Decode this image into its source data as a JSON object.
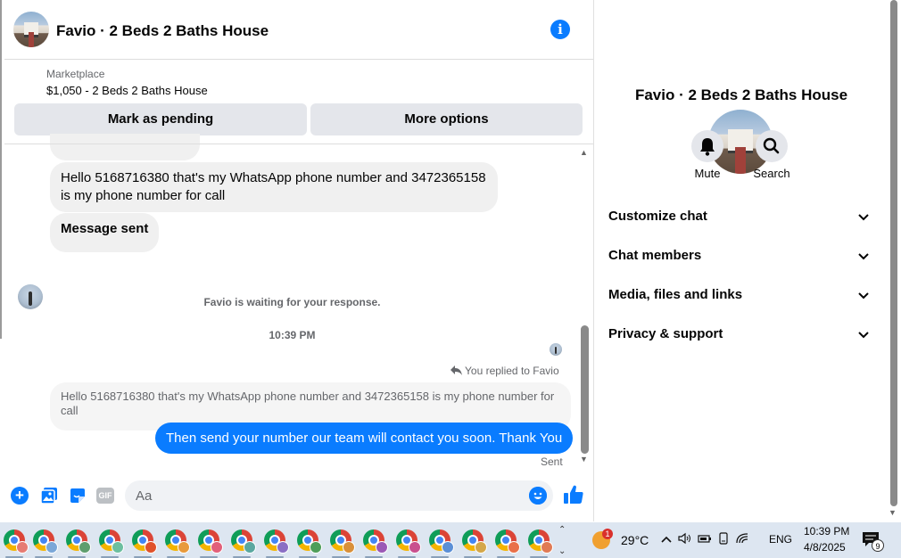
{
  "header": {
    "title": "Favio · 2 Beds 2 Baths House"
  },
  "marketplace": {
    "label": "Marketplace",
    "listing": "$1,050 - 2 Beds 2 Baths House",
    "pending_label": "Mark as pending",
    "more_label": "More options"
  },
  "messages": {
    "msg1": "Hello 5168716380 that's my WhatsApp phone number and 3472365158 is my phone number for call",
    "msg2": "Message sent",
    "waiting": "Favio is waiting for your response.",
    "time": "10:39 PM",
    "replied": "You replied to Favio",
    "quoted": "Hello 5168716380 that's my WhatsApp phone number and 3472365158 is my phone number for call",
    "outgoing": "Then send your number our team will contact you soon. Thank You",
    "status": "Sent"
  },
  "composer": {
    "placeholder": "Aa",
    "gif_label": "GIF"
  },
  "panel": {
    "title": "Favio · 2 Beds 2 Baths House",
    "mute_label": "Mute",
    "search_label": "Search",
    "rows": [
      "Customize chat",
      "Chat members",
      "Media, files and links",
      "Privacy & support"
    ]
  },
  "taskbar": {
    "weather_badge": "1",
    "temperature": "29°C",
    "language": "ENG",
    "time": "10:39 PM",
    "date": "4/8/2025",
    "notification_count": "9"
  },
  "colors": {
    "accent": "#0a7cff",
    "bubble_in": "#f0f0f0",
    "button_gray": "#e4e6eb",
    "taskbar": "#dde6f1"
  }
}
